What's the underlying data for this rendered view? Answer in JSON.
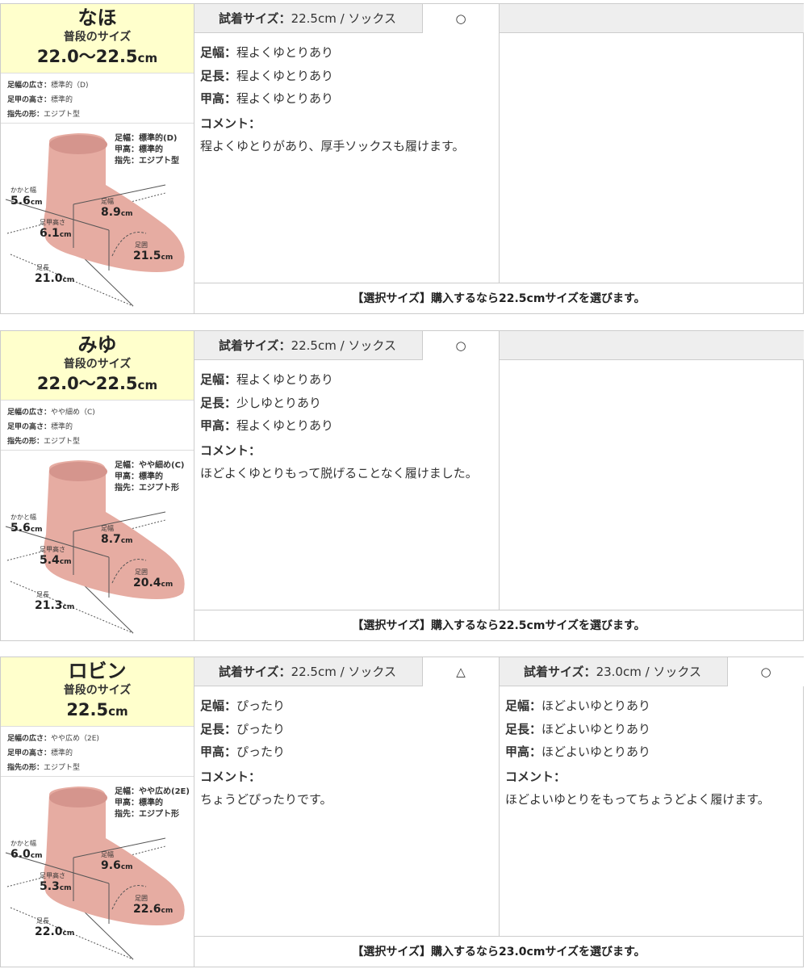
{
  "cards": [
    {
      "name": "なほ",
      "usual_label": "普段のサイズ",
      "usual_size": "22.0〜22.5",
      "usual_unit": "cm",
      "attrs": [
        {
          "label": "足幅の広さ：",
          "value": "標準的（D)"
        },
        {
          "label": "足甲の高さ：",
          "value": "標準的"
        },
        {
          "label": "指先の形：",
          "value": "エジプト型"
        }
      ],
      "foot_note": "足幅：標準的(D)\n甲高：標準的\n指先：エジプト型",
      "measures": {
        "heel_label": "かかと幅",
        "heel": "5.6",
        "instep_label": "足甲高さ",
        "instep": "6.1",
        "width_label": "足幅",
        "width": "8.9",
        "girth_label": "足囲",
        "girth": "21.5",
        "length_label": "足長",
        "length": "21.0",
        "unit": "cm"
      },
      "trials": [
        {
          "header_label": "試着サイズ：",
          "header_value": "22.5cm / ソックス",
          "mark": "○",
          "rows": [
            {
              "label": "足幅：",
              "value": "程よくゆとりあり"
            },
            {
              "label": "足長：",
              "value": "程よくゆとりあり"
            },
            {
              "label": "甲高：",
              "value": "程よくゆとりあり"
            }
          ],
          "comment_label": "コメント：",
          "comment": "程よくゆとりがあり、厚手ソックスも履けます。"
        },
        {
          "header_label": "",
          "header_value": "",
          "mark": "",
          "rows": [],
          "comment_label": "",
          "comment": ""
        }
      ],
      "selection": "【選択サイズ】購入するなら22.5cmサイズを選びます。"
    },
    {
      "name": "みゆ",
      "usual_label": "普段のサイズ",
      "usual_size": "22.0〜22.5",
      "usual_unit": "cm",
      "attrs": [
        {
          "label": "足幅の広さ：",
          "value": "やや細め（C)"
        },
        {
          "label": "足甲の高さ：",
          "value": "標準的"
        },
        {
          "label": "指先の形：",
          "value": "エジプト型"
        }
      ],
      "foot_note": "足幅：やや細め(C)\n甲高：標準的\n指先：エジプト形",
      "measures": {
        "heel_label": "かかと幅",
        "heel": "5.6",
        "instep_label": "足甲高さ",
        "instep": "5.4",
        "width_label": "足幅",
        "width": "8.7",
        "girth_label": "足囲",
        "girth": "20.4",
        "length_label": "足長",
        "length": "21.3",
        "unit": "cm"
      },
      "trials": [
        {
          "header_label": "試着サイズ：",
          "header_value": "22.5cm / ソックス",
          "mark": "○",
          "rows": [
            {
              "label": "足幅：",
              "value": "程よくゆとりあり"
            },
            {
              "label": "足長：",
              "value": "少しゆとりあり"
            },
            {
              "label": "甲高：",
              "value": "程よくゆとりあり"
            }
          ],
          "comment_label": "コメント：",
          "comment": "ほどよくゆとりもって脱げることなく履けました。"
        },
        {
          "header_label": "",
          "header_value": "",
          "mark": "",
          "rows": [],
          "comment_label": "",
          "comment": ""
        }
      ],
      "selection": "【選択サイズ】購入するなら22.5cmサイズを選びます。"
    },
    {
      "name": "ロビン",
      "usual_label": "普段のサイズ",
      "usual_size": "22.5",
      "usual_unit": "cm",
      "attrs": [
        {
          "label": "足幅の広さ：",
          "value": "やや広め（2E)"
        },
        {
          "label": "足甲の高さ：",
          "value": "標準的"
        },
        {
          "label": "指先の形：",
          "value": "エジプト型"
        }
      ],
      "foot_note": "足幅：やや広め(2E)\n甲高：標準的\n指先：エジプト形",
      "measures": {
        "heel_label": "かかと幅",
        "heel": "6.0",
        "instep_label": "足甲高さ",
        "instep": "5.3",
        "width_label": "足幅",
        "width": "9.6",
        "girth_label": "足囲",
        "girth": "22.6",
        "length_label": "足長",
        "length": "22.0",
        "unit": "cm"
      },
      "trials": [
        {
          "header_label": "試着サイズ：",
          "header_value": "22.5cm / ソックス",
          "mark": "△",
          "rows": [
            {
              "label": "足幅：",
              "value": "ぴったり"
            },
            {
              "label": "足長：",
              "value": "ぴったり"
            },
            {
              "label": "甲高：",
              "value": "ぴったり"
            }
          ],
          "comment_label": "コメント：",
          "comment": "ちょうどぴったりです。"
        },
        {
          "header_label": "試着サイズ：",
          "header_value": "23.0cm / ソックス",
          "mark": "○",
          "rows": [
            {
              "label": "足幅：",
              "value": "ほどよいゆとりあり"
            },
            {
              "label": "足長：",
              "value": "ほどよいゆとりあり"
            },
            {
              "label": "甲高：",
              "value": "ほどよいゆとりあり"
            }
          ],
          "comment_label": "コメント：",
          "comment": "ほどよいゆとりをもってちょうどよく履けます。"
        }
      ],
      "selection": "【選択サイズ】購入するなら23.0cmサイズを選びます。"
    }
  ]
}
